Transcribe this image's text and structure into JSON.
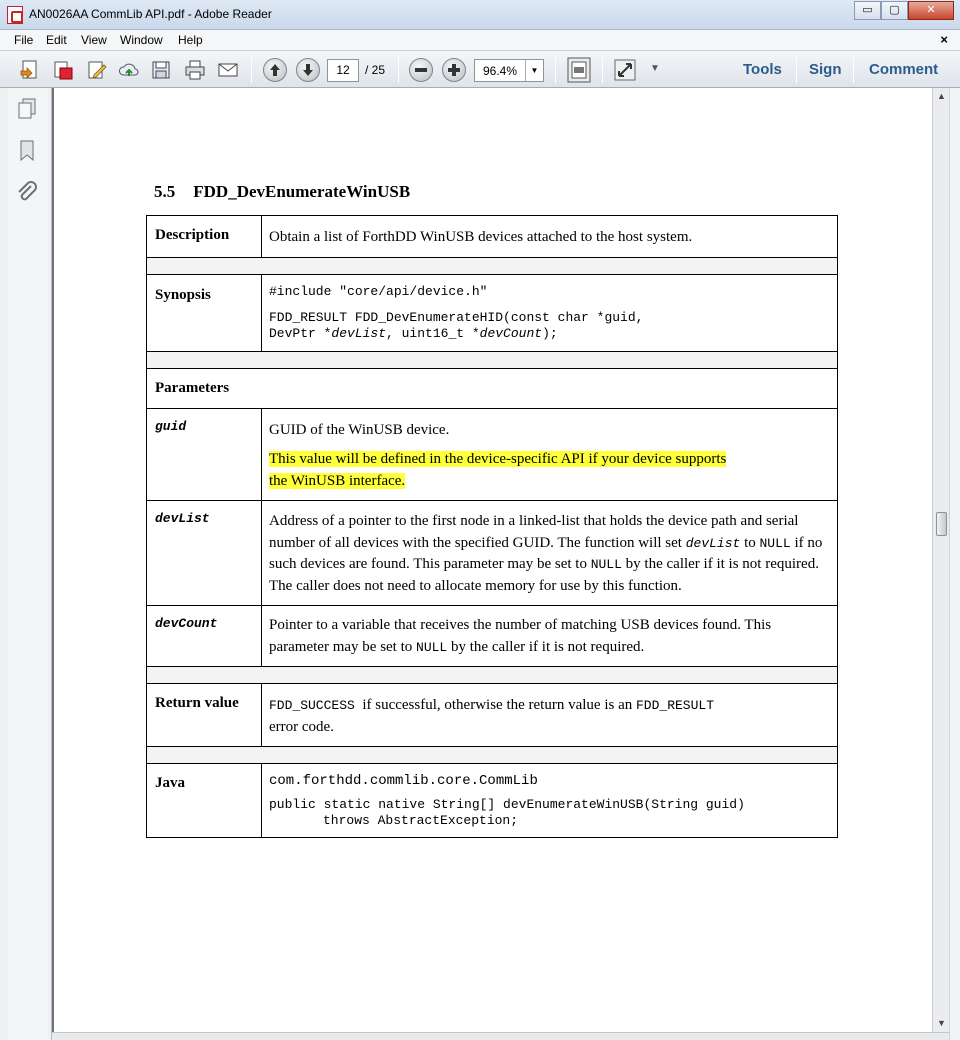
{
  "window": {
    "title": "AN0026AA CommLib API.pdf - Adobe Reader",
    "buttons": {
      "minimize": "▭",
      "maximize": "▢",
      "close": "✕"
    }
  },
  "menu": {
    "items": [
      "File",
      "Edit",
      "View",
      "Window",
      "Help"
    ],
    "close_doc": "×"
  },
  "toolbar": {
    "page_current": "12",
    "page_total": "/ 25",
    "zoom": "96.4%",
    "links": {
      "tools": "Tools",
      "sign": "Sign",
      "comment": "Comment"
    }
  },
  "document": {
    "section_number": "5.5",
    "section_title": "FDD_DevEnumerateWinUSB",
    "description": {
      "label": "Description",
      "text": "Obtain a list of ForthDD WinUSB devices attached to the host system."
    },
    "synopsis": {
      "label": "Synopsis",
      "include": "#include \"core/api/device.h\"",
      "sig_line1": "FDD_RESULT FDD_DevEnumerateHID(const char *guid,",
      "sig_l2_a": "DevPtr *",
      "sig_l2_b": "devList",
      "sig_l2_c": ", uint16_t *",
      "sig_l2_d": "devCount",
      "sig_l2_e": ");"
    },
    "parameters": {
      "label": "Parameters",
      "guid": {
        "name": "guid",
        "text1": "GUID of the WinUSB device.",
        "text2_line1": "This value will be defined in the device-specific API if your device supports",
        "text2_line2": "the WinUSB interface."
      },
      "devList": {
        "name": "devList",
        "a": "Address of a pointer to the first node in a linked-list that holds the device path and serial number of all devices with the specified GUID. The function will set ",
        "b": "devList",
        "c": " to ",
        "d": "NULL",
        "e": " if no such devices are found. This parameter may be set to ",
        "f": "NULL",
        "g": " by the caller if it is not required. The caller does not need to allocate memory for use by this function."
      },
      "devCount": {
        "name": "devCount",
        "a": "Pointer to a variable that receives the number of matching USB devices found. This parameter may be set to ",
        "b": "NULL",
        "c": " by the caller if it is not required."
      }
    },
    "return_value": {
      "label": "Return value",
      "a": "FDD_SUCCESS",
      "b": "  if successful, otherwise the return value is an ",
      "c": "FDD_RESULT",
      "d": " error code."
    },
    "java": {
      "label": "Java",
      "cls": "com.forthdd.commlib.core.CommLib",
      "line1": "public static native String[] devEnumerateWinUSB(String guid)",
      "line2": "throws AbstractException;"
    }
  }
}
